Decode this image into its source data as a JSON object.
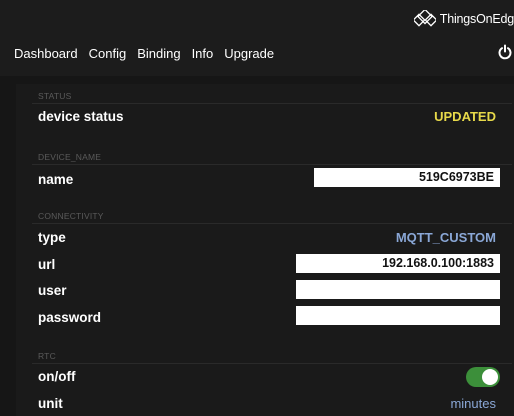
{
  "brand": {
    "name": "ThingsOnEdg"
  },
  "nav": {
    "items": [
      "Dashboard",
      "Config",
      "Binding",
      "Info",
      "Upgrade"
    ]
  },
  "status": {
    "section": "STATUS",
    "device_status_label": "device status",
    "device_status_value": "UPDATED",
    "value_color": "#e7d94a"
  },
  "device_name": {
    "section": "DEVICE_NAME",
    "name_label": "name",
    "name_value": "519C6973BE"
  },
  "connectivity": {
    "section": "CONNECTIVITY",
    "type_label": "type",
    "type_value": "MQTT_CUSTOM",
    "type_color": "#8aa7d6",
    "url_label": "url",
    "url_value": "192.168.0.100:1883",
    "user_label": "user",
    "user_value": "",
    "password_label": "password",
    "password_value": ""
  },
  "rtc": {
    "section": "RTC",
    "onoff_label": "on/off",
    "onoff_state": true,
    "toggle_color": "#3c8f3a",
    "unit_label": "unit",
    "unit_value": "minutes",
    "unit_color": "#8aa7d6"
  },
  "icons": {
    "brand_logo": "brand-logo-icon",
    "power": "power-icon"
  }
}
